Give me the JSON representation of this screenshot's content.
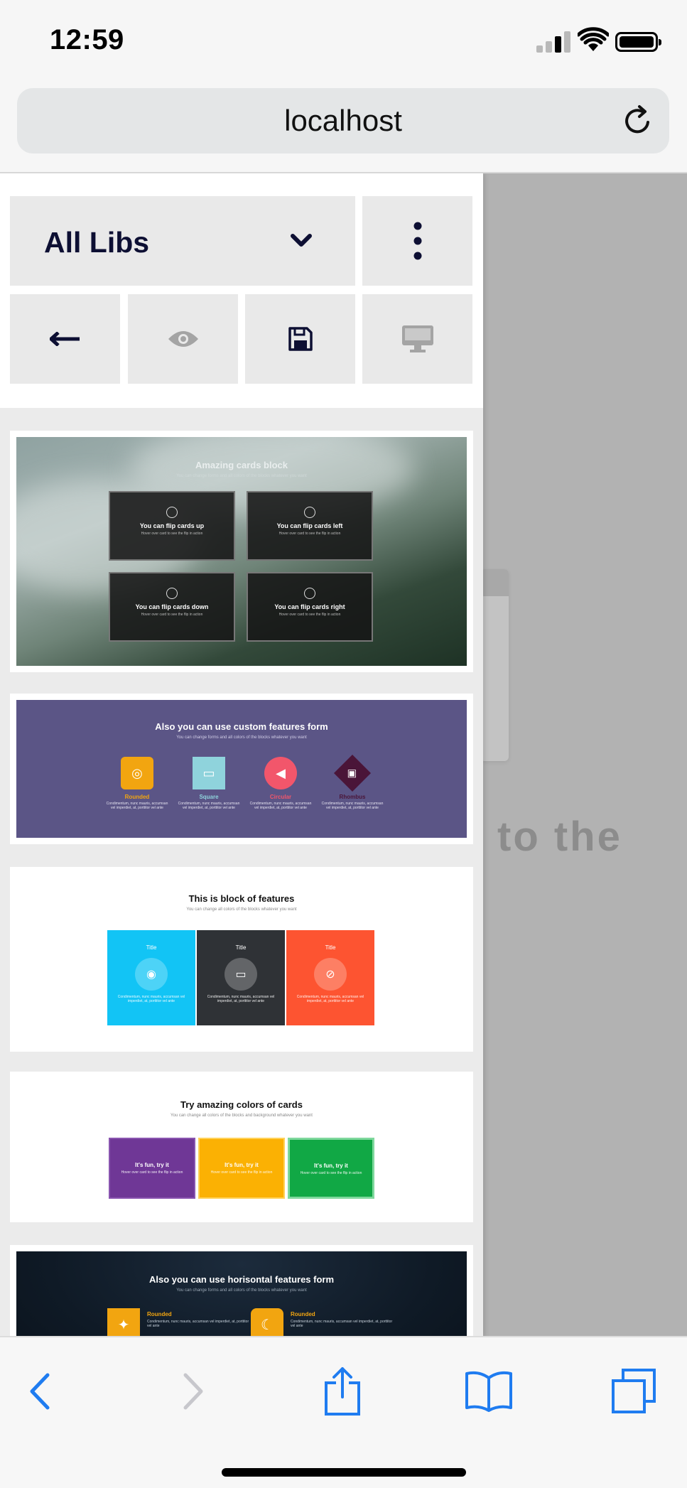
{
  "status_bar": {
    "time": "12:59",
    "icons": [
      "cellular-signal-icon",
      "wifi-icon",
      "battery-icon"
    ]
  },
  "browser": {
    "url": "localhost",
    "reload_icon": "reload-icon"
  },
  "background_page": {
    "partial_text": "to the"
  },
  "panel": {
    "library_select": {
      "selected": "All Libs",
      "icon": "chevron-down-icon"
    },
    "more_icon": "more-vertical-icon",
    "toolbar_icons": [
      "arrow-left-icon",
      "eye-icon",
      "save-icon",
      "desktop-icon"
    ]
  },
  "thumbnails": [
    {
      "title": "Amazing cards block",
      "subtitle": "You can change forms and all colors of the blocks whatever you want",
      "cards": [
        {
          "title": "You can flip cards up",
          "text": "Hover over card to see the flip in action"
        },
        {
          "title": "You can flip cards left",
          "text": "Hover over card to see the flip in action"
        },
        {
          "title": "You can flip cards down",
          "text": "Hover over card to see the flip in action"
        },
        {
          "title": "You can flip cards right",
          "text": "Hover over card to see the flip in action"
        }
      ]
    },
    {
      "title": "Also you can use custom features form",
      "subtitle": "You can change forms and all colors of the blocks whatever you want",
      "features": [
        {
          "label": "Rounded",
          "color": "#f2a510",
          "text": "Condimentum, nunc mauris, accumsan vel imperdiet, at, porttitor vel ante"
        },
        {
          "label": "Square",
          "color": "#8fd3dc",
          "text": "Condimentum, nunc mauris, accumsan vel imperdiet, at, porttitor vel ante"
        },
        {
          "label": "Circular",
          "color": "#f2566b",
          "text": "Condimentum, nunc mauris, accumsan vel imperdiet, at, porttitor vel ante"
        },
        {
          "label": "Rhombus",
          "color": "#4a1538",
          "text": "Condimentum, nunc mauris, accumsan vel imperdiet, at, porttitor vel ante"
        }
      ]
    },
    {
      "title": "This is block of features",
      "subtitle": "You can change all colors of the blocks whatever you want",
      "columns": [
        {
          "title": "Title",
          "color": "#12c4f5",
          "text": "Condimentum, nunc mauris, accumsan vel imperdiet, at, porttitor vel ante"
        },
        {
          "title": "Title",
          "color": "#2f3236",
          "text": "Condimentum, nunc mauris, accumsan vel imperdiet, at, porttitor vel ante"
        },
        {
          "title": "Title",
          "color": "#fd5431",
          "text": "Condimentum, nunc mauris, accumsan vel imperdiet, at, porttitor vel ante"
        }
      ]
    },
    {
      "title": "Try amazing colors of cards",
      "subtitle": "You can change all colors of the blocks and background whatever you want",
      "cards": [
        {
          "title": "It's fun, try it",
          "text": "Hover over card to see the flip in action",
          "color": "#6f3796"
        },
        {
          "title": "It's fun, try it",
          "text": "Hover over card to see the flip in action",
          "color": "#fbb103"
        },
        {
          "title": "It's fun, try it",
          "text": "Hover over card to see the flip in action",
          "color": "#11a845"
        }
      ]
    },
    {
      "title": "Also you can use horisontal features form",
      "subtitle": "You can change forms and all colors of the blocks whatever you want",
      "features": [
        {
          "label": "Rounded",
          "text": "Condimentum, nunc mauris, accumsan vel imperdiet, at, porttitor vel ante"
        },
        {
          "label": "Rounded",
          "text": "Condimentum, nunc mauris, accumsan vel imperdiet, at, porttitor vel ante"
        }
      ]
    }
  ],
  "bottom_toolbar": {
    "icons": [
      "back-icon",
      "forward-icon",
      "share-icon",
      "bookmarks-icon",
      "tabs-icon"
    ]
  },
  "colors": {
    "accent": "#1f7cf0",
    "panel_text": "#0d0f33"
  }
}
